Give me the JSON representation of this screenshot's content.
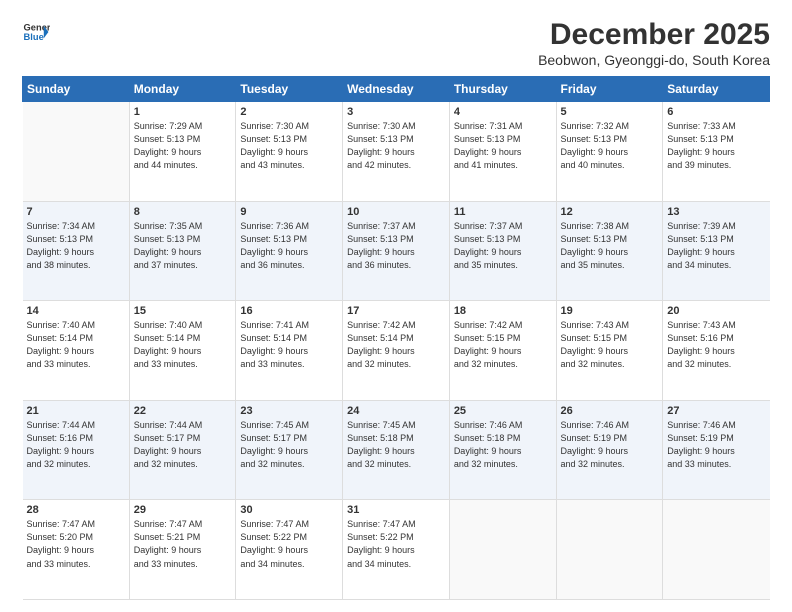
{
  "header": {
    "logo_line1": "General",
    "logo_line2": "Blue",
    "title": "December 2025",
    "subtitle": "Beobwon, Gyeonggi-do, South Korea"
  },
  "days_of_week": [
    "Sunday",
    "Monday",
    "Tuesday",
    "Wednesday",
    "Thursday",
    "Friday",
    "Saturday"
  ],
  "weeks": [
    [
      {
        "day": "",
        "info": ""
      },
      {
        "day": "1",
        "info": "Sunrise: 7:29 AM\nSunset: 5:13 PM\nDaylight: 9 hours\nand 44 minutes."
      },
      {
        "day": "2",
        "info": "Sunrise: 7:30 AM\nSunset: 5:13 PM\nDaylight: 9 hours\nand 43 minutes."
      },
      {
        "day": "3",
        "info": "Sunrise: 7:30 AM\nSunset: 5:13 PM\nDaylight: 9 hours\nand 42 minutes."
      },
      {
        "day": "4",
        "info": "Sunrise: 7:31 AM\nSunset: 5:13 PM\nDaylight: 9 hours\nand 41 minutes."
      },
      {
        "day": "5",
        "info": "Sunrise: 7:32 AM\nSunset: 5:13 PM\nDaylight: 9 hours\nand 40 minutes."
      },
      {
        "day": "6",
        "info": "Sunrise: 7:33 AM\nSunset: 5:13 PM\nDaylight: 9 hours\nand 39 minutes."
      }
    ],
    [
      {
        "day": "7",
        "info": "Sunrise: 7:34 AM\nSunset: 5:13 PM\nDaylight: 9 hours\nand 38 minutes."
      },
      {
        "day": "8",
        "info": "Sunrise: 7:35 AM\nSunset: 5:13 PM\nDaylight: 9 hours\nand 37 minutes."
      },
      {
        "day": "9",
        "info": "Sunrise: 7:36 AM\nSunset: 5:13 PM\nDaylight: 9 hours\nand 36 minutes."
      },
      {
        "day": "10",
        "info": "Sunrise: 7:37 AM\nSunset: 5:13 PM\nDaylight: 9 hours\nand 36 minutes."
      },
      {
        "day": "11",
        "info": "Sunrise: 7:37 AM\nSunset: 5:13 PM\nDaylight: 9 hours\nand 35 minutes."
      },
      {
        "day": "12",
        "info": "Sunrise: 7:38 AM\nSunset: 5:13 PM\nDaylight: 9 hours\nand 35 minutes."
      },
      {
        "day": "13",
        "info": "Sunrise: 7:39 AM\nSunset: 5:13 PM\nDaylight: 9 hours\nand 34 minutes."
      }
    ],
    [
      {
        "day": "14",
        "info": "Sunrise: 7:40 AM\nSunset: 5:14 PM\nDaylight: 9 hours\nand 33 minutes."
      },
      {
        "day": "15",
        "info": "Sunrise: 7:40 AM\nSunset: 5:14 PM\nDaylight: 9 hours\nand 33 minutes."
      },
      {
        "day": "16",
        "info": "Sunrise: 7:41 AM\nSunset: 5:14 PM\nDaylight: 9 hours\nand 33 minutes."
      },
      {
        "day": "17",
        "info": "Sunrise: 7:42 AM\nSunset: 5:14 PM\nDaylight: 9 hours\nand 32 minutes."
      },
      {
        "day": "18",
        "info": "Sunrise: 7:42 AM\nSunset: 5:15 PM\nDaylight: 9 hours\nand 32 minutes."
      },
      {
        "day": "19",
        "info": "Sunrise: 7:43 AM\nSunset: 5:15 PM\nDaylight: 9 hours\nand 32 minutes."
      },
      {
        "day": "20",
        "info": "Sunrise: 7:43 AM\nSunset: 5:16 PM\nDaylight: 9 hours\nand 32 minutes."
      }
    ],
    [
      {
        "day": "21",
        "info": "Sunrise: 7:44 AM\nSunset: 5:16 PM\nDaylight: 9 hours\nand 32 minutes."
      },
      {
        "day": "22",
        "info": "Sunrise: 7:44 AM\nSunset: 5:17 PM\nDaylight: 9 hours\nand 32 minutes."
      },
      {
        "day": "23",
        "info": "Sunrise: 7:45 AM\nSunset: 5:17 PM\nDaylight: 9 hours\nand 32 minutes."
      },
      {
        "day": "24",
        "info": "Sunrise: 7:45 AM\nSunset: 5:18 PM\nDaylight: 9 hours\nand 32 minutes."
      },
      {
        "day": "25",
        "info": "Sunrise: 7:46 AM\nSunset: 5:18 PM\nDaylight: 9 hours\nand 32 minutes."
      },
      {
        "day": "26",
        "info": "Sunrise: 7:46 AM\nSunset: 5:19 PM\nDaylight: 9 hours\nand 32 minutes."
      },
      {
        "day": "27",
        "info": "Sunrise: 7:46 AM\nSunset: 5:19 PM\nDaylight: 9 hours\nand 33 minutes."
      }
    ],
    [
      {
        "day": "28",
        "info": "Sunrise: 7:47 AM\nSunset: 5:20 PM\nDaylight: 9 hours\nand 33 minutes."
      },
      {
        "day": "29",
        "info": "Sunrise: 7:47 AM\nSunset: 5:21 PM\nDaylight: 9 hours\nand 33 minutes."
      },
      {
        "day": "30",
        "info": "Sunrise: 7:47 AM\nSunset: 5:22 PM\nDaylight: 9 hours\nand 34 minutes."
      },
      {
        "day": "31",
        "info": "Sunrise: 7:47 AM\nSunset: 5:22 PM\nDaylight: 9 hours\nand 34 minutes."
      },
      {
        "day": "",
        "info": ""
      },
      {
        "day": "",
        "info": ""
      },
      {
        "day": "",
        "info": ""
      }
    ]
  ]
}
